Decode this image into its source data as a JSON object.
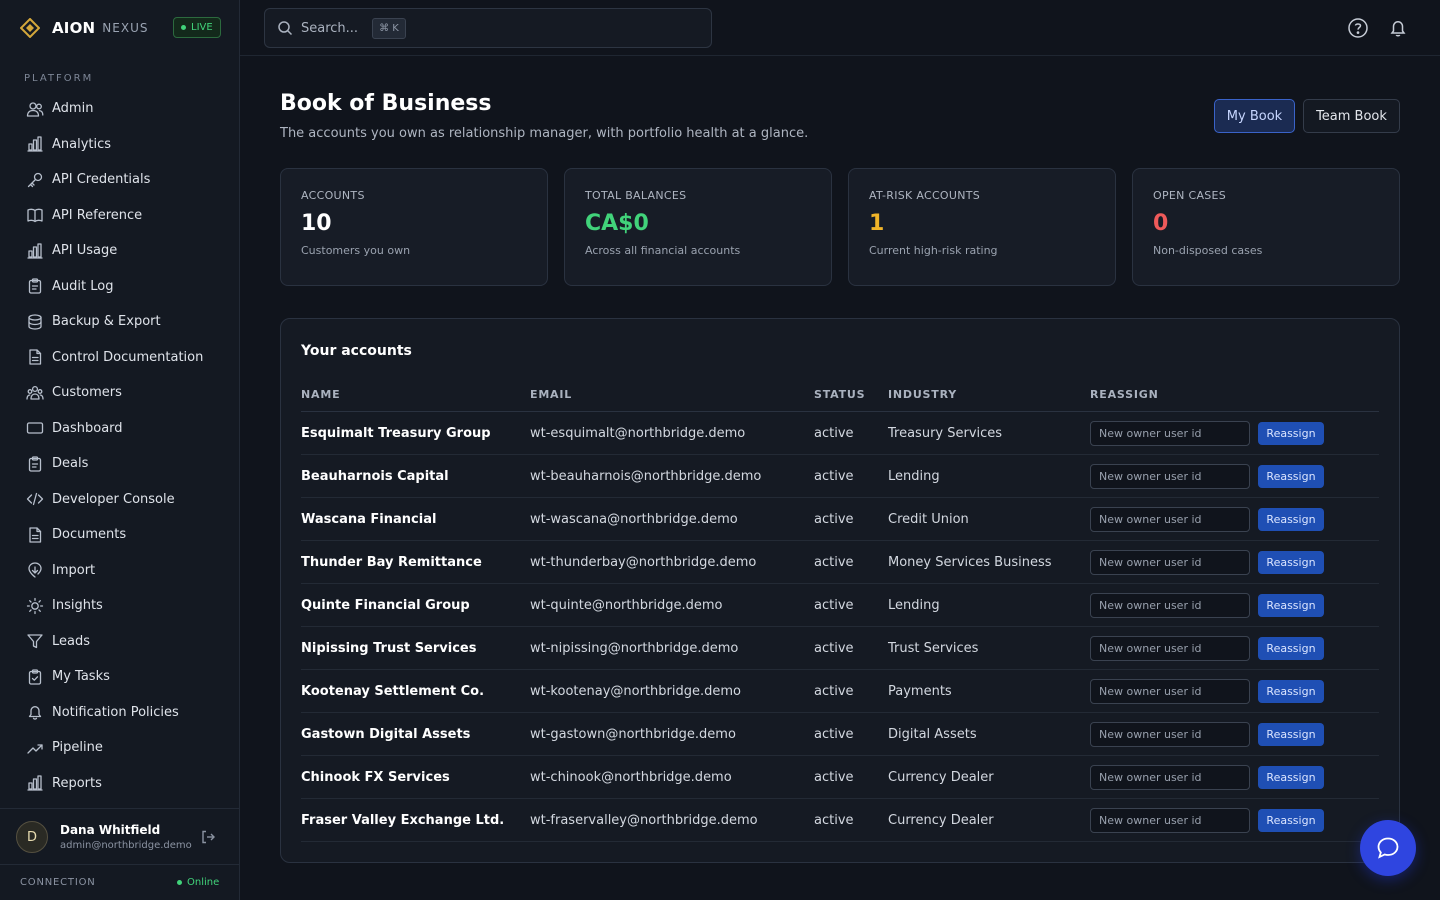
{
  "brand": {
    "name": "AION",
    "sub": "NEXUS",
    "live_label": "LIVE"
  },
  "colors": {
    "accent": "#2f45e0",
    "success": "#41d37a",
    "warning": "#f0b429",
    "danger": "#ef5a5a",
    "brand_gold": "#d4a73b"
  },
  "sidebar": {
    "section_label": "PLATFORM",
    "items": [
      {
        "label": "Admin",
        "icon": "users-icon"
      },
      {
        "label": "Analytics",
        "icon": "bar-chart-icon"
      },
      {
        "label": "API Credentials",
        "icon": "key-icon"
      },
      {
        "label": "API Reference",
        "icon": "book-icon"
      },
      {
        "label": "API Usage",
        "icon": "bar-chart-icon"
      },
      {
        "label": "Audit Log",
        "icon": "clipboard-icon"
      },
      {
        "label": "Backup & Export",
        "icon": "database-icon"
      },
      {
        "label": "Control Documentation",
        "icon": "file-icon"
      },
      {
        "label": "Customers",
        "icon": "people-icon"
      },
      {
        "label": "Dashboard",
        "icon": "monitor-icon"
      },
      {
        "label": "Deals",
        "icon": "clipboard-icon"
      },
      {
        "label": "Developer Console",
        "icon": "code-icon"
      },
      {
        "label": "Documents",
        "icon": "file-icon"
      },
      {
        "label": "Import",
        "icon": "import-icon"
      },
      {
        "label": "Insights",
        "icon": "lightbulb-icon"
      },
      {
        "label": "Leads",
        "icon": "funnel-icon"
      },
      {
        "label": "My Tasks",
        "icon": "clipboard-check-icon"
      },
      {
        "label": "Notification Policies",
        "icon": "bell-icon"
      },
      {
        "label": "Pipeline",
        "icon": "trend-icon"
      },
      {
        "label": "Reports",
        "icon": "bar-chart-icon"
      }
    ],
    "user": {
      "initial": "D",
      "name": "Dana Whitfield",
      "email": "admin@northbridge.demo"
    },
    "connection_label": "CONNECTION",
    "connection_status": "Online"
  },
  "topbar": {
    "search_placeholder": "Search...",
    "shortcut": "⌘ K"
  },
  "page": {
    "title": "Book of Business",
    "subtitle": "The accounts you own as relationship manager, with portfolio health at a glance.",
    "toggle": {
      "my_book": "My Book",
      "team_book": "Team Book",
      "selected": "My Book"
    }
  },
  "stats": [
    {
      "label": "ACCOUNTS",
      "value": "10",
      "caption": "Customers you own",
      "color": "#ffffff"
    },
    {
      "label": "TOTAL BALANCES",
      "value": "CA$0",
      "caption": "Across all financial accounts",
      "color": "#41d37a"
    },
    {
      "label": "AT-RISK ACCOUNTS",
      "value": "1",
      "caption": "Current high-risk rating",
      "color": "#f0b429"
    },
    {
      "label": "OPEN CASES",
      "value": "0",
      "caption": "Non-disposed cases",
      "color": "#ef5a5a"
    }
  ],
  "accounts": {
    "title": "Your accounts",
    "columns": {
      "name": "NAME",
      "email": "EMAIL",
      "status": "STATUS",
      "industry": "INDUSTRY",
      "reassign": "REASSIGN"
    },
    "input_placeholder": "New owner user id",
    "button_label": "Reassign",
    "rows": [
      {
        "name": "Esquimalt Treasury Group",
        "email": "wt-esquimalt@northbridge.demo",
        "status": "active",
        "industry": "Treasury Services"
      },
      {
        "name": "Beauharnois Capital",
        "email": "wt-beauharnois@northbridge.demo",
        "status": "active",
        "industry": "Lending"
      },
      {
        "name": "Wascana Financial",
        "email": "wt-wascana@northbridge.demo",
        "status": "active",
        "industry": "Credit Union"
      },
      {
        "name": "Thunder Bay Remittance",
        "email": "wt-thunderbay@northbridge.demo",
        "status": "active",
        "industry": "Money Services Business"
      },
      {
        "name": "Quinte Financial Group",
        "email": "wt-quinte@northbridge.demo",
        "status": "active",
        "industry": "Lending"
      },
      {
        "name": "Nipissing Trust Services",
        "email": "wt-nipissing@northbridge.demo",
        "status": "active",
        "industry": "Trust Services"
      },
      {
        "name": "Kootenay Settlement Co.",
        "email": "wt-kootenay@northbridge.demo",
        "status": "active",
        "industry": "Payments"
      },
      {
        "name": "Gastown Digital Assets",
        "email": "wt-gastown@northbridge.demo",
        "status": "active",
        "industry": "Digital Assets"
      },
      {
        "name": "Chinook FX Services",
        "email": "wt-chinook@northbridge.demo",
        "status": "active",
        "industry": "Currency Dealer"
      },
      {
        "name": "Fraser Valley Exchange Ltd.",
        "email": "wt-fraservalley@northbridge.demo",
        "status": "active",
        "industry": "Currency Dealer"
      }
    ]
  }
}
